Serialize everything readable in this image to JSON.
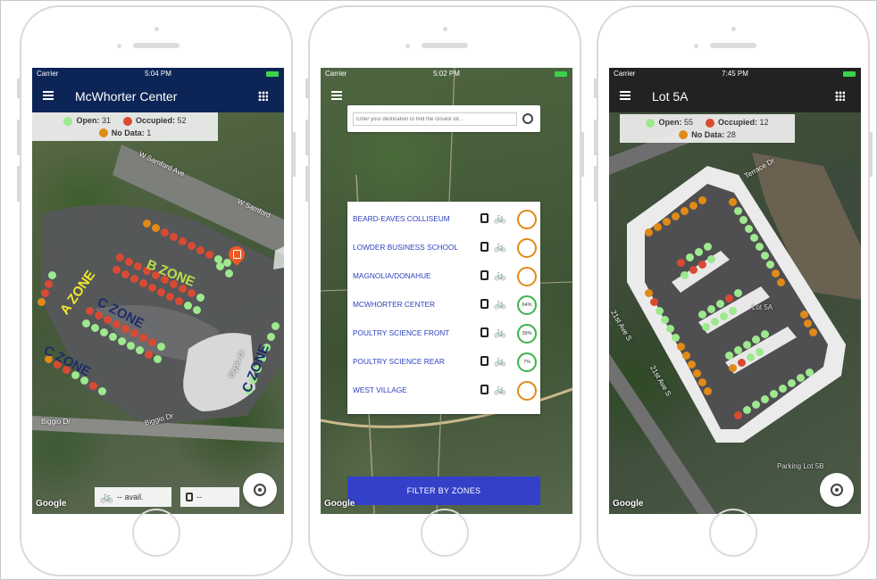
{
  "colors": {
    "open": "#9ee88e",
    "occupied": "#d94a33",
    "nodata": "#e08a18",
    "navy_appbar": "#0d2556",
    "dark_appbar": "#222222",
    "filter_button": "#3440c8",
    "lot_link": "#2d3fbf"
  },
  "phone1": {
    "carrier": "Carrier",
    "time": "5:04 PM",
    "title": "McWhorter Center",
    "legend": {
      "open_label": "Open:",
      "open_value": "31",
      "occupied_label": "Occupied:",
      "occupied_value": "52",
      "nodata_label": "No Data:",
      "nodata_value": "1"
    },
    "road_1": "W Samford Ave",
    "road_2": "W Samford",
    "road_3": "Biggio Dr",
    "road_4": "Biggio Dr",
    "road_5": "Biggio Dr",
    "zones": {
      "a": "A ZONE",
      "b": "B ZONE",
      "c1": "C ZONE",
      "c2": "C ZONE",
      "c3": "C ZONE"
    },
    "bike_avail": "-- avail.",
    "bus_avail": "--",
    "google": "Google"
  },
  "phone2": {
    "carrier": "Carrier",
    "time": "5:02 PM",
    "search_placeholder": "Enter your destination to find the closest lot...",
    "lots": [
      {
        "name": "BEARD-EAVES COLLISEUM",
        "pct": "",
        "status": "nodata"
      },
      {
        "name": "LOWDER BUSINESS SCHOOL",
        "pct": "",
        "status": "nodata"
      },
      {
        "name": "MAGNOLIA/DONAHUE",
        "pct": "",
        "status": "nodata"
      },
      {
        "name": "MCWHORTER CENTER",
        "pct": "64%",
        "status": "open"
      },
      {
        "name": "POULTRY SCIENCE FRONT",
        "pct": "39%",
        "status": "open"
      },
      {
        "name": "POULTRY SCIENCE REAR",
        "pct": "7%",
        "status": "open"
      },
      {
        "name": "WEST VILLAGE",
        "pct": "",
        "status": "nodata"
      }
    ],
    "filter_label": "FILTER BY ZONES",
    "google": "Google"
  },
  "phone3": {
    "carrier": "Carrier",
    "time": "7:45 PM",
    "title": "Lot 5A",
    "legend": {
      "open_label": "Open:",
      "open_value": "55",
      "occupied_label": "Occupied:",
      "occupied_value": "12",
      "nodata_label": "No Data:",
      "nodata_value": "28"
    },
    "road_1": "Terrace Dr",
    "road_2": "21st Ave S",
    "road_3": "21st Ave S",
    "lot_label": "Lot 5A",
    "parking_label": "Parking Lot 5B",
    "google": "Google"
  }
}
